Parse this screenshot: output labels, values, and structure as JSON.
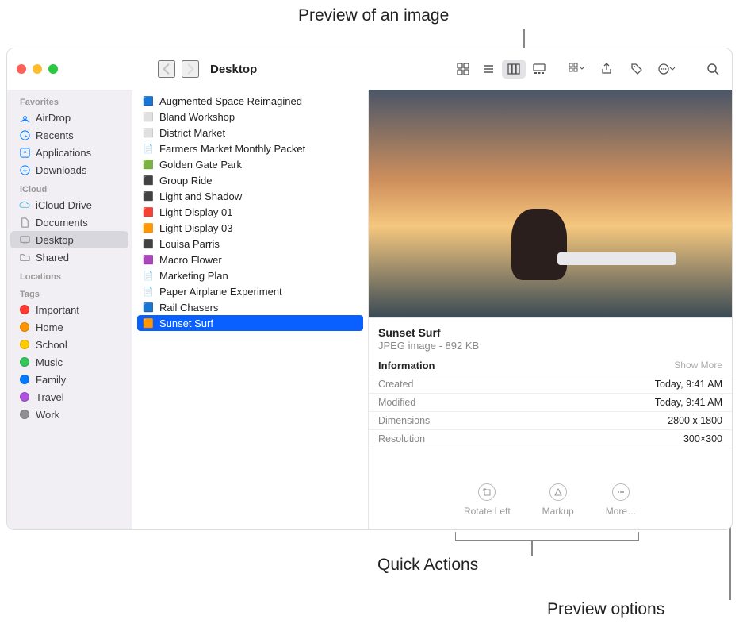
{
  "callouts": {
    "preview_image": "Preview of an image",
    "quick_actions": "Quick Actions",
    "preview_options": "Preview options"
  },
  "toolbar": {
    "location": "Desktop"
  },
  "sidebar": {
    "groups": {
      "favorites": {
        "label": "Favorites",
        "items": [
          "AirDrop",
          "Recents",
          "Applications",
          "Downloads"
        ]
      },
      "icloud": {
        "label": "iCloud",
        "items": [
          "iCloud Drive",
          "Documents",
          "Desktop",
          "Shared"
        ]
      },
      "locations": {
        "label": "Locations"
      },
      "tags": {
        "label": "Tags",
        "items": [
          "Important",
          "Home",
          "School",
          "Music",
          "Family",
          "Travel",
          "Work"
        ]
      }
    },
    "selected": "Desktop",
    "tag_colors": [
      "#ff3b30",
      "#ff9500",
      "#ffcc00",
      "#34c759",
      "#007aff",
      "#af52de",
      "#8e8e93"
    ]
  },
  "files": {
    "items": [
      "Augmented Space Reimagined",
      "Bland Workshop",
      "District Market",
      "Farmers Market Monthly Packet",
      "Golden Gate Park",
      "Group Ride",
      "Light and Shadow",
      "Light Display 01",
      "Light Display 03",
      "Louisa Parris",
      "Macro Flower",
      "Marketing Plan",
      "Paper Airplane Experiment",
      "Rail Chasers",
      "Sunset Surf"
    ],
    "selected": "Sunset Surf"
  },
  "preview": {
    "title": "Sunset Surf",
    "subtitle": "JPEG image - 892 KB",
    "info_header": "Information",
    "show_more": "Show More",
    "rows": [
      {
        "k": "Created",
        "v": "Today, 9:41 AM"
      },
      {
        "k": "Modified",
        "v": "Today, 9:41 AM"
      },
      {
        "k": "Dimensions",
        "v": "2800 x 1800"
      },
      {
        "k": "Resolution",
        "v": "300×300"
      }
    ],
    "actions": {
      "rotate": "Rotate Left",
      "markup": "Markup",
      "more": "More…"
    }
  }
}
